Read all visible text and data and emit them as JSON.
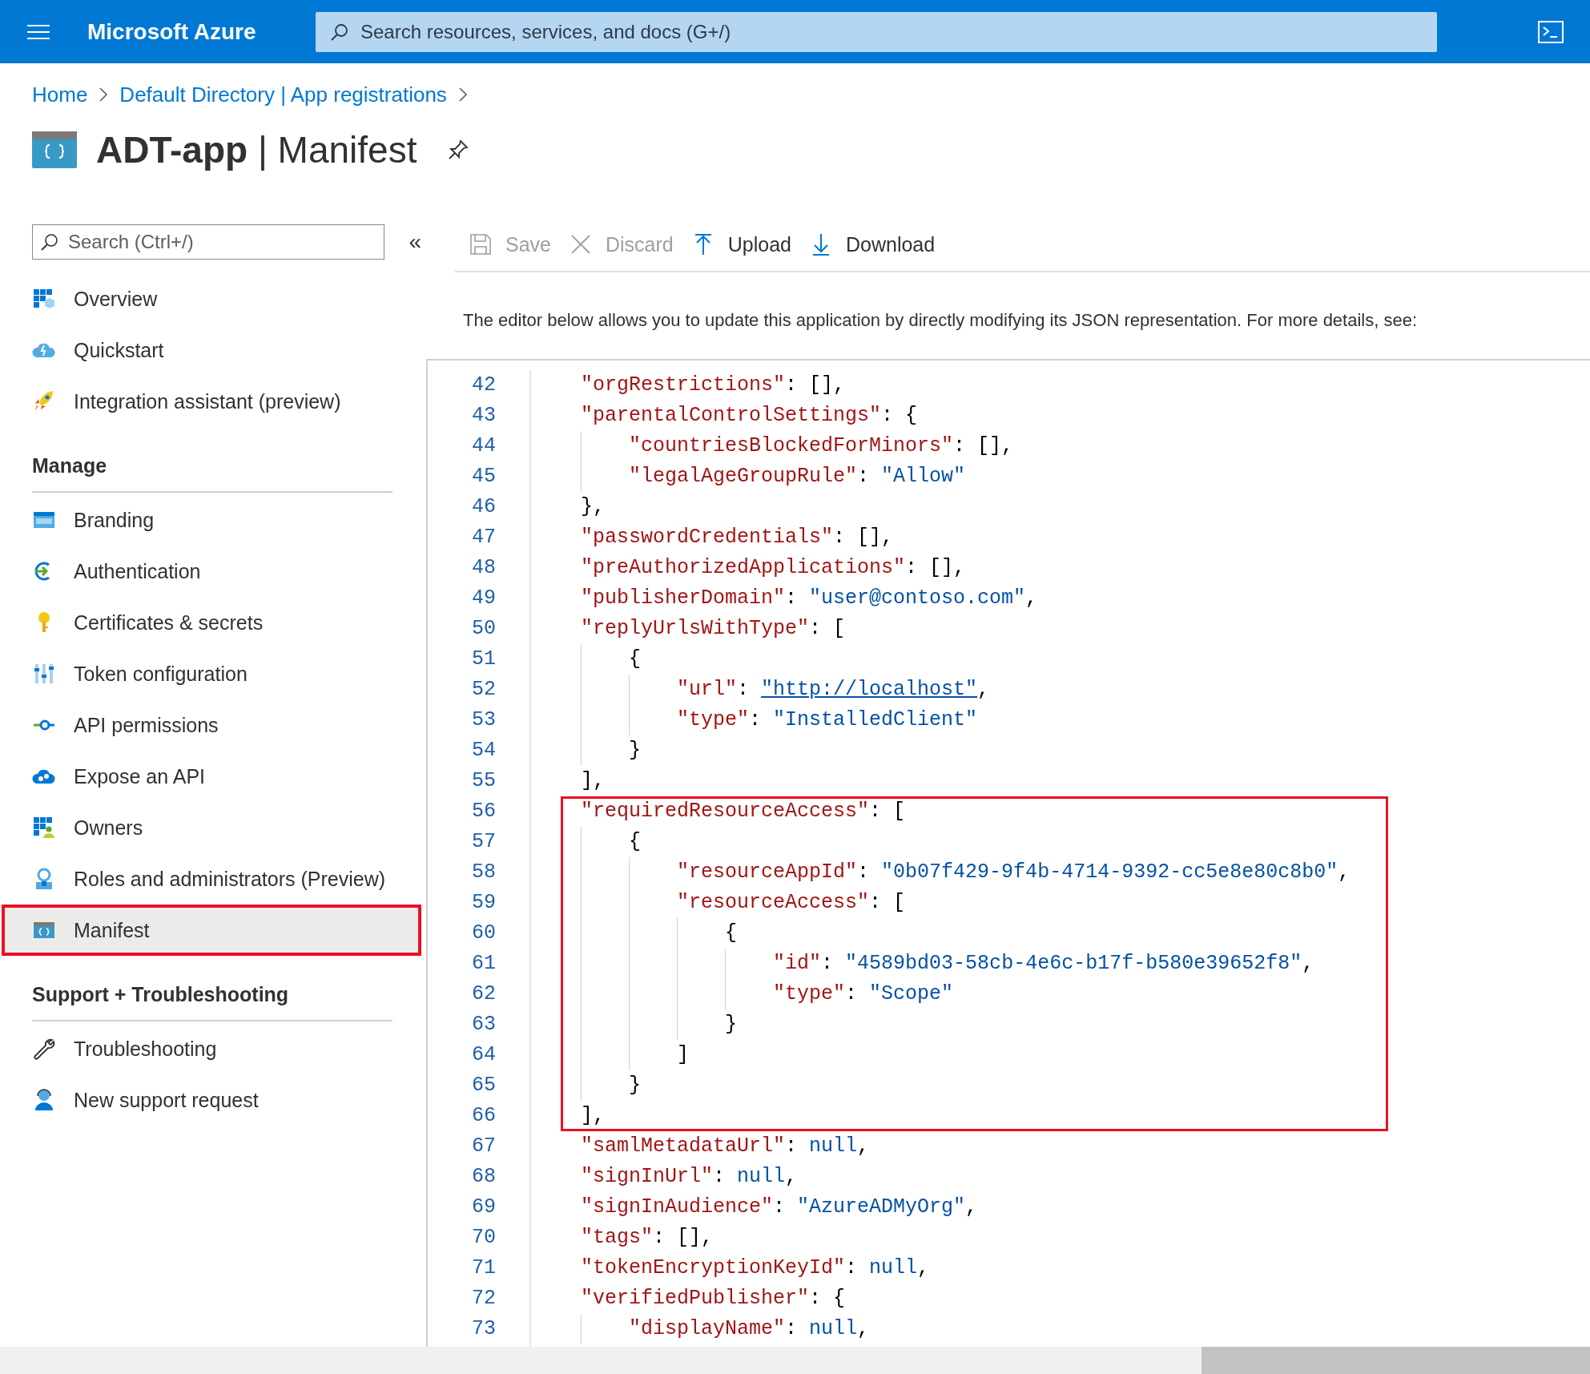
{
  "header": {
    "brand": "Microsoft Azure",
    "search": {
      "placeholder": "Search resources, services, and docs (G+/)"
    }
  },
  "breadcrumb": [
    {
      "label": "Home"
    },
    {
      "label": "Default Directory | App registrations"
    }
  ],
  "page": {
    "title": "**ADT-app** | Manifest"
  },
  "sidebar": {
    "search": {
      "placeholder": "Search (Ctrl+/)"
    },
    "collapse": "«",
    "sections": [
      {
        "items": [
          {
            "label": "Overview",
            "selected": false,
            "highlighted": false
          },
          {
            "label": "Quickstart",
            "selected": false,
            "highlighted": false
          },
          {
            "label": "Integration assistant (preview)",
            "selected": false,
            "highlighted": false
          }
        ]
      },
      {
        "heading": "Manage",
        "items": [
          {
            "label": "Branding",
            "selected": false,
            "highlighted": false
          },
          {
            "label": "Authentication",
            "selected": false,
            "highlighted": false
          },
          {
            "label": "Certificates & secrets",
            "selected": false,
            "highlighted": false
          },
          {
            "label": "Token configuration",
            "selected": false,
            "highlighted": false
          },
          {
            "label": "API permissions",
            "selected": false,
            "highlighted": false
          },
          {
            "label": "Expose an API",
            "selected": false,
            "highlighted": false
          },
          {
            "label": "Owners",
            "selected": false,
            "highlighted": false
          },
          {
            "label": "Roles and administrators (Preview)",
            "selected": false,
            "highlighted": false
          },
          {
            "label": "Manifest",
            "selected": true,
            "highlighted": true
          }
        ]
      },
      {
        "heading": "Support + Troubleshooting",
        "items": [
          {
            "label": "Troubleshooting",
            "selected": false,
            "highlighted": false
          },
          {
            "label": "New support request",
            "selected": false,
            "highlighted": false
          }
        ]
      }
    ]
  },
  "toolbar": [
    {
      "label": "Save",
      "disabled": true
    },
    {
      "label": "Discard",
      "disabled": true
    },
    {
      "label": "Upload",
      "disabled": false
    },
    {
      "label": "Download",
      "disabled": false
    }
  ],
  "description": "The editor below allows you to update this application by directly modifying its JSON representation. For more details, see:",
  "editor": {
    "lines": [
      {
        "number": "42",
        "highlighted": false,
        "parts": [
          {
            "kind": "key",
            "text": "\"orgRestrictions\""
          },
          {
            "kind": "punct",
            "text": ": [],"
          }
        ]
      },
      {
        "number": "43",
        "highlighted": false,
        "parts": [
          {
            "kind": "key",
            "text": "\"parentalControlSettings\""
          },
          {
            "kind": "punct",
            "text": ": {"
          }
        ]
      },
      {
        "number": "44",
        "highlighted": false,
        "parts": [
          {
            "kind": "key",
            "text": "    \"countriesBlockedForMinors\""
          },
          {
            "kind": "punct",
            "text": ": [],"
          }
        ]
      },
      {
        "number": "45",
        "highlighted": false,
        "parts": [
          {
            "kind": "key",
            "text": "    \"legalAgeGroupRule\""
          },
          {
            "kind": "punct",
            "text": ": "
          },
          {
            "kind": "string",
            "text": "\"Allow\""
          }
        ]
      },
      {
        "number": "46",
        "highlighted": false,
        "parts": [
          {
            "kind": "punct",
            "text": "},"
          }
        ]
      },
      {
        "number": "47",
        "highlighted": false,
        "parts": [
          {
            "kind": "key",
            "text": "\"passwordCredentials\""
          },
          {
            "kind": "punct",
            "text": ": [],"
          }
        ]
      },
      {
        "number": "48",
        "highlighted": false,
        "parts": [
          {
            "kind": "key",
            "text": "\"preAuthorizedApplications\""
          },
          {
            "kind": "punct",
            "text": ": [],"
          }
        ]
      },
      {
        "number": "49",
        "highlighted": false,
        "parts": [
          {
            "kind": "key",
            "text": "\"publisherDomain\""
          },
          {
            "kind": "punct",
            "text": ": "
          },
          {
            "kind": "string",
            "text": "\"user@contoso.com\""
          },
          {
            "kind": "punct",
            "text": ","
          }
        ]
      },
      {
        "number": "50",
        "highlighted": false,
        "parts": [
          {
            "kind": "key",
            "text": "\"replyUrlsWithType\""
          },
          {
            "kind": "punct",
            "text": ": ["
          }
        ]
      },
      {
        "number": "51",
        "highlighted": false,
        "parts": [
          {
            "kind": "punct",
            "text": "    {"
          }
        ]
      },
      {
        "number": "52",
        "highlighted": false,
        "parts": [
          {
            "kind": "key",
            "text": "        \"url\""
          },
          {
            "kind": "punct",
            "text": ": "
          },
          {
            "kind": "link",
            "text": "\"http://localhost\""
          },
          {
            "kind": "punct",
            "text": ","
          }
        ]
      },
      {
        "number": "53",
        "highlighted": false,
        "parts": [
          {
            "kind": "key",
            "text": "        \"type\""
          },
          {
            "kind": "punct",
            "text": ": "
          },
          {
            "kind": "string",
            "text": "\"InstalledClient\""
          }
        ]
      },
      {
        "number": "54",
        "highlighted": false,
        "parts": [
          {
            "kind": "punct",
            "text": "    }"
          }
        ]
      },
      {
        "number": "55",
        "highlighted": false,
        "parts": [
          {
            "kind": "punct",
            "text": "],"
          }
        ]
      },
      {
        "number": "56",
        "highlighted": true,
        "parts": [
          {
            "kind": "key",
            "text": "\"requiredResourceAccess\""
          },
          {
            "kind": "punct",
            "text": ": ["
          }
        ]
      },
      {
        "number": "57",
        "highlighted": true,
        "parts": [
          {
            "kind": "punct",
            "text": "    {"
          }
        ]
      },
      {
        "number": "58",
        "highlighted": true,
        "parts": [
          {
            "kind": "key",
            "text": "        \"resourceAppId\""
          },
          {
            "kind": "punct",
            "text": ": "
          },
          {
            "kind": "string",
            "text": "\"0b07f429-9f4b-4714-9392-cc5e8e80c8b0\""
          },
          {
            "kind": "punct",
            "text": ","
          }
        ]
      },
      {
        "number": "59",
        "highlighted": true,
        "parts": [
          {
            "kind": "key",
            "text": "        \"resourceAccess\""
          },
          {
            "kind": "punct",
            "text": ": ["
          }
        ]
      },
      {
        "number": "60",
        "highlighted": true,
        "parts": [
          {
            "kind": "punct",
            "text": "            {"
          }
        ]
      },
      {
        "number": "61",
        "highlighted": true,
        "parts": [
          {
            "kind": "key",
            "text": "                \"id\""
          },
          {
            "kind": "punct",
            "text": ": "
          },
          {
            "kind": "string",
            "text": "\"4589bd03-58cb-4e6c-b17f-b580e39652f8\""
          },
          {
            "kind": "punct",
            "text": ","
          }
        ]
      },
      {
        "number": "62",
        "highlighted": true,
        "parts": [
          {
            "kind": "key",
            "text": "                \"type\""
          },
          {
            "kind": "punct",
            "text": ": "
          },
          {
            "kind": "string",
            "text": "\"Scope\""
          }
        ]
      },
      {
        "number": "63",
        "highlighted": true,
        "parts": [
          {
            "kind": "punct",
            "text": "            }"
          }
        ]
      },
      {
        "number": "64",
        "highlighted": true,
        "parts": [
          {
            "kind": "punct",
            "text": "        ]"
          }
        ]
      },
      {
        "number": "65",
        "highlighted": true,
        "parts": [
          {
            "kind": "punct",
            "text": "    }"
          }
        ]
      },
      {
        "number": "66",
        "highlighted": true,
        "parts": [
          {
            "kind": "punct",
            "text": "],"
          }
        ]
      },
      {
        "number": "67",
        "highlighted": false,
        "parts": [
          {
            "kind": "key",
            "text": "\"samlMetadataUrl\""
          },
          {
            "kind": "punct",
            "text": ": "
          },
          {
            "kind": "literal",
            "text": "null"
          },
          {
            "kind": "punct",
            "text": ","
          }
        ]
      },
      {
        "number": "68",
        "highlighted": false,
        "parts": [
          {
            "kind": "key",
            "text": "\"signInUrl\""
          },
          {
            "kind": "punct",
            "text": ": "
          },
          {
            "kind": "literal",
            "text": "null"
          },
          {
            "kind": "punct",
            "text": ","
          }
        ]
      },
      {
        "number": "69",
        "highlighted": false,
        "parts": [
          {
            "kind": "key",
            "text": "\"signInAudience\""
          },
          {
            "kind": "punct",
            "text": ": "
          },
          {
            "kind": "string",
            "text": "\"AzureADMyOrg\""
          },
          {
            "kind": "punct",
            "text": ","
          }
        ]
      },
      {
        "number": "70",
        "highlighted": false,
        "parts": [
          {
            "kind": "key",
            "text": "\"tags\""
          },
          {
            "kind": "punct",
            "text": ": [],"
          }
        ]
      },
      {
        "number": "71",
        "highlighted": false,
        "parts": [
          {
            "kind": "key",
            "text": "\"tokenEncryptionKeyId\""
          },
          {
            "kind": "punct",
            "text": ": "
          },
          {
            "kind": "literal",
            "text": "null"
          },
          {
            "kind": "punct",
            "text": ","
          }
        ]
      },
      {
        "number": "72",
        "highlighted": false,
        "parts": [
          {
            "kind": "key",
            "text": "\"verifiedPublisher\""
          },
          {
            "kind": "punct",
            "text": ": {"
          }
        ]
      },
      {
        "number": "73",
        "highlighted": false,
        "parts": [
          {
            "kind": "key",
            "text": "    \"displayName\""
          },
          {
            "kind": "punct",
            "text": ": "
          },
          {
            "kind": "literal",
            "text": "null"
          },
          {
            "kind": "punct",
            "text": ","
          }
        ]
      }
    ]
  }
}
